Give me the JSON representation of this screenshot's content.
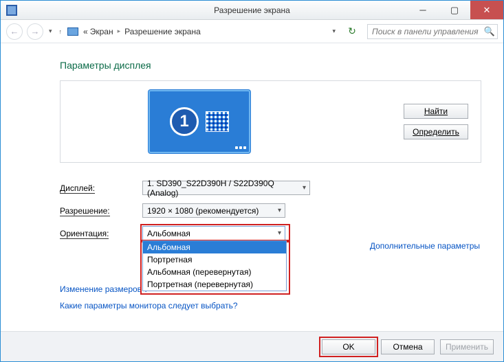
{
  "titlebar": {
    "title": "Разрешение экрана"
  },
  "breadcrumb": {
    "root_prefix": "«",
    "item1": "Экран",
    "item2": "Разрешение экрана"
  },
  "search": {
    "placeholder": "Поиск в панели управления"
  },
  "heading": "Параметры дисплея",
  "monitor": {
    "number": "1"
  },
  "buttons": {
    "find": "Найти",
    "detect": "Определить"
  },
  "form": {
    "display_label": "Дисплей:",
    "display_value": "1. SD390_S22D390H / S22D390Q (Analog)",
    "resolution_label": "Разрешение:",
    "resolution_value": "1920 × 1080 (рекомендуется)",
    "orientation_label": "Ориентация:",
    "orientation_value": "Альбомная",
    "orientation_options": [
      "Альбомная",
      "Портретная",
      "Альбомная (перевернутая)",
      "Портретная (перевернутая)"
    ]
  },
  "advanced_link": "Дополнительные параметры",
  "link1": "Изменение размеров т",
  "link2": "Какие параметры монитора следует выбрать?",
  "footer": {
    "ok": "OK",
    "cancel": "Отмена",
    "apply": "Применить"
  }
}
